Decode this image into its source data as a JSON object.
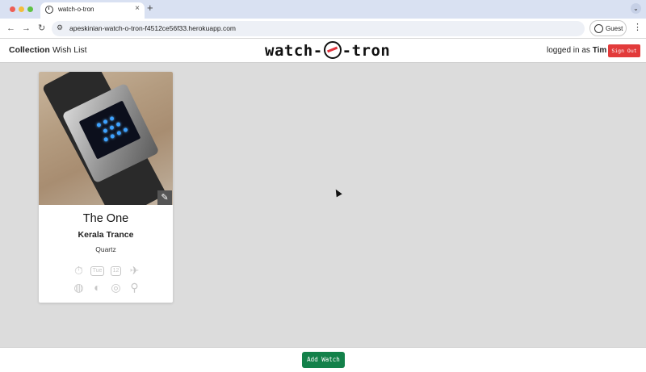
{
  "browser": {
    "tab_title": "watch-o-tron",
    "tab_close": "×",
    "new_tab": "+",
    "tab_menu": "⌄",
    "url": "apeskinian-watch-o-tron-f4512ce56f33.herokuapp.com",
    "guest_label": "Guest",
    "nav_back": "←",
    "nav_forward": "→",
    "nav_reload": "↻",
    "site_info_icon": "⚙",
    "menu": "⋮"
  },
  "nav": {
    "collection": "Collection",
    "wishlist": "Wish List",
    "logo_left": "watch-",
    "logo_right": "-tron",
    "logged_in_prefix": "logged in as",
    "user": "Tim",
    "sign_out": "Sign Out"
  },
  "watch": {
    "name": "The One",
    "model": "Kerala Trance",
    "movement": "Quartz",
    "edit_icon": "✎",
    "features": [
      {
        "icon": "stopwatch-icon",
        "glyph": "⏱"
      },
      {
        "icon": "date-window-icon",
        "glyph": "Tue"
      },
      {
        "icon": "twelve-hour-icon",
        "glyph": "12"
      },
      {
        "icon": "airplane-icon",
        "glyph": "✈"
      },
      {
        "icon": "globe-icon",
        "glyph": "◍"
      },
      {
        "icon": "moon-phase-icon",
        "glyph": "◐"
      },
      {
        "icon": "target-icon",
        "glyph": "◎"
      },
      {
        "icon": "rocket-icon",
        "glyph": "⚲"
      }
    ]
  },
  "footer": {
    "add_watch": "Add Watch"
  },
  "colors": {
    "sign_out_bg": "#e23b3b",
    "add_watch_bg": "#13814a",
    "page_bg": "#dcdcdc",
    "logo_accent": "#e0313b"
  }
}
